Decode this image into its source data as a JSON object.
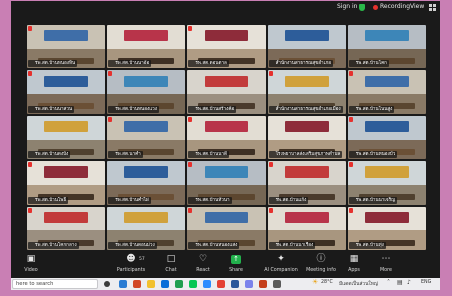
{
  "top_bar": {
    "sign_in": "Sign in",
    "recording": "Recording",
    "view": "View",
    "shield_color": "#2bb84a",
    "record_color": "#e5312e"
  },
  "gallery": {
    "tiles": [
      {
        "name": "รพ.สต.บ้านหนองหิน",
        "muted": true
      },
      {
        "name": "รพ.สต.บ้านนาอ้อ",
        "muted": false
      },
      {
        "name": "รพ.สต.ดอนตาล",
        "muted": true
      },
      {
        "name": "สำนักงานสาธารณสุขอำเภอ",
        "muted": false
      },
      {
        "name": "รพ.สต.บ้านโคก",
        "muted": false
      },
      {
        "name": "รพ.สต.บ้านนาสวน",
        "muted": true
      },
      {
        "name": "รพ.สต.บ้านหนองแวง",
        "muted": true
      },
      {
        "name": "รพ.สต.บ้านสร้างค้อ",
        "muted": false
      },
      {
        "name": "สำนักงานสาธารณสุขอำเภอเมือง",
        "muted": true
      },
      {
        "name": "รพ.สต.บ้านโนนสูง",
        "muted": true
      },
      {
        "name": "รพ.สต.บ้านดงบัง",
        "muted": false
      },
      {
        "name": "รพ.สต.นาคำ",
        "muted": true
      },
      {
        "name": "รพ.สต.บ้านนาดี",
        "muted": true
      },
      {
        "name": "โรงพยาบาลส่งเสริมสุขภาพตำบล",
        "muted": false
      },
      {
        "name": "รพ.สต.บ้านหนองบัว",
        "muted": true
      },
      {
        "name": "รพ.สต.บ้านโพธิ์",
        "muted": true
      },
      {
        "name": "รพ.สต.บ้านคำไผ่",
        "muted": false
      },
      {
        "name": "รพ.สต.บ้านหัวนา",
        "muted": true
      },
      {
        "name": "รพ.สต.บ้านแก้ง",
        "muted": true
      },
      {
        "name": "รพ.สต.บ้านนาเจริญ",
        "muted": true
      },
      {
        "name": "รพ.สต.บ้านโคกกลาง",
        "muted": true
      },
      {
        "name": "รพ.สต.บ้านดอนม่วง",
        "muted": false
      },
      {
        "name": "รพ.สต.บ้านหนองแสง",
        "muted": true
      },
      {
        "name": "รพ.สต.บ้านนาเรือง",
        "muted": true
      },
      {
        "name": "รพ.สต.บ้านทุ่ง",
        "muted": true
      }
    ]
  },
  "toolbar": {
    "video": "Video",
    "participants": "Participants",
    "participants_count": "57",
    "chat": "Chat",
    "react": "React",
    "share": "Share",
    "ai_companion": "AI Companion",
    "meeting_info": "Meeting info",
    "apps": "Apps",
    "more": "More",
    "share_color": "#22b14c"
  },
  "taskbar": {
    "search_placeholder": "here to search",
    "temperature": "28°C",
    "weather": "มีแดดเป็นส่วนใหญ่",
    "language": "ENG"
  }
}
